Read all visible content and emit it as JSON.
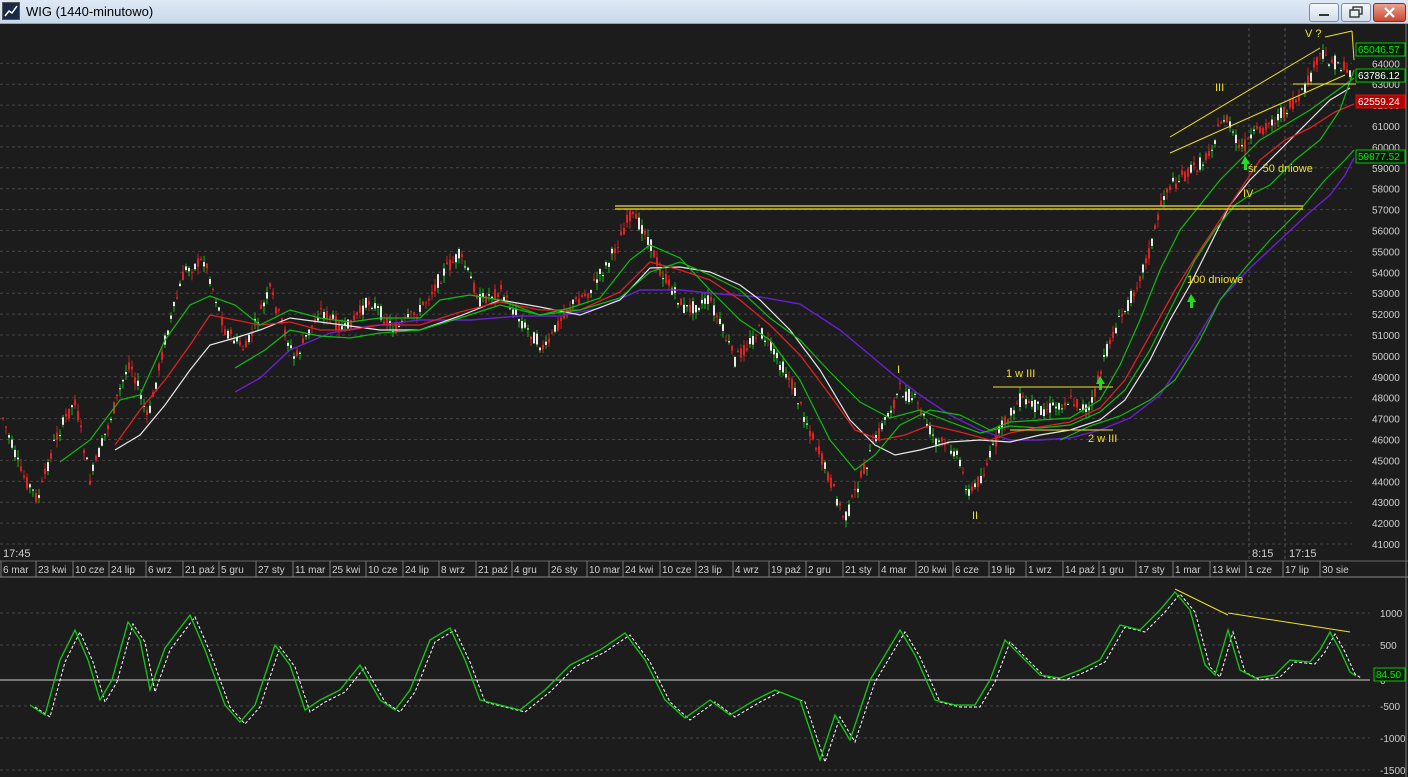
{
  "window": {
    "title": "WIG (1440-minutowo)"
  },
  "price_panel": {
    "time_label_left": "17:45",
    "time_labels_right": [
      "8:15",
      "17:15"
    ],
    "y_ticks": [
      "41000",
      "42000",
      "43000",
      "44000",
      "45000",
      "46000",
      "47000",
      "48000",
      "49000",
      "50000",
      "51000",
      "52000",
      "53000",
      "54000",
      "55000",
      "56000",
      "57000",
      "58000",
      "59000",
      "60000",
      "61000",
      "62000",
      "63000",
      "64000"
    ],
    "badges": [
      {
        "text": "65046.57",
        "color": "#00cc00"
      },
      {
        "text": "63786.12",
        "color": "#00cc00"
      },
      {
        "text": "62559.24",
        "color": "#dd1111"
      },
      {
        "text": "59877.52",
        "color": "#00cc00"
      }
    ],
    "annotations": {
      "wave_I": "I",
      "wave_II": "II",
      "wave_III": "III",
      "wave_IV": "IV",
      "wave_V": "V ?",
      "one_w_three": "1 w III",
      "two_w_three": "2 w III",
      "ma50": "śr. 50 dniowe",
      "ma100": "100 dniowe"
    },
    "colors": {
      "yellow": "#f0e030",
      "green": "#11cc11",
      "red": "#dd2222",
      "white": "#e8e8e8",
      "purple": "#6a1fd0",
      "grid": "#4a4a4a"
    }
  },
  "date_axis": [
    "6 mar",
    "23 kwi",
    "10 cze",
    "24 lip",
    "6 wrz",
    "21 paź",
    "5 gru",
    "27 sty",
    "11 mar",
    "25 kwi",
    "10 cze",
    "24 lip",
    "8 wrz",
    "21 paź",
    "4 gru",
    "26 sty",
    "10 mar",
    "24 kwi",
    "10 cze",
    "23 lip",
    "4 wrz",
    "19 paź",
    "2 gru",
    "21 sty",
    "4 mar",
    "20 kwi",
    "6 cze",
    "19 lip",
    "1 wrz",
    "14 paź",
    "1 gru",
    "17 sty",
    "1 mar",
    "13 kwi",
    "1 cze",
    "17 lip",
    "30 sie"
  ],
  "oscillator_panel": {
    "y_ticks": [
      "1000",
      "500",
      "0",
      "-500",
      "-1000",
      "-1500"
    ],
    "badge": {
      "text": "84.50",
      "color": "#00cc00"
    }
  }
}
